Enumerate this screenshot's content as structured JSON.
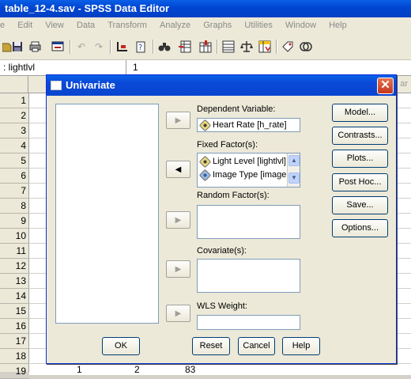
{
  "window": {
    "title": "table_12-4.sav - SPSS Data Editor"
  },
  "menu": [
    "e",
    "Edit",
    "View",
    "Data",
    "Transform",
    "Analyze",
    "Graphs",
    "Utilities",
    "Window",
    "Help"
  ],
  "cell_editor": {
    "reference": ": lightlvl",
    "value": "1"
  },
  "grid": {
    "header_partial": "ar",
    "row_numbers": [
      "1",
      "2",
      "3",
      "4",
      "5",
      "6",
      "7",
      "8",
      "9",
      "10",
      "11",
      "12",
      "13",
      "14",
      "15",
      "16",
      "17",
      "18",
      "19"
    ],
    "last_row_values": [
      "1",
      "2",
      "83"
    ]
  },
  "dialog": {
    "title": "Univariate",
    "close_glyph": "✕",
    "dependent_label": "Dependent Variable:",
    "dependent_value": "Heart Rate [h_rate]",
    "fixed_label": "Fixed Factor(s):",
    "fixed_items": [
      "Light Level [lightlvl]",
      "Image Type [image"
    ],
    "random_label": "Random Factor(s):",
    "covariates_label": "Covariate(s):",
    "wls_label": "WLS Weight:",
    "side_buttons": [
      "Model...",
      "Contrasts...",
      "Plots...",
      "Post Hoc...",
      "Save...",
      "Options..."
    ],
    "ok": "OK",
    "reset": "Reset",
    "cancel": "Cancel",
    "help": "Help"
  }
}
